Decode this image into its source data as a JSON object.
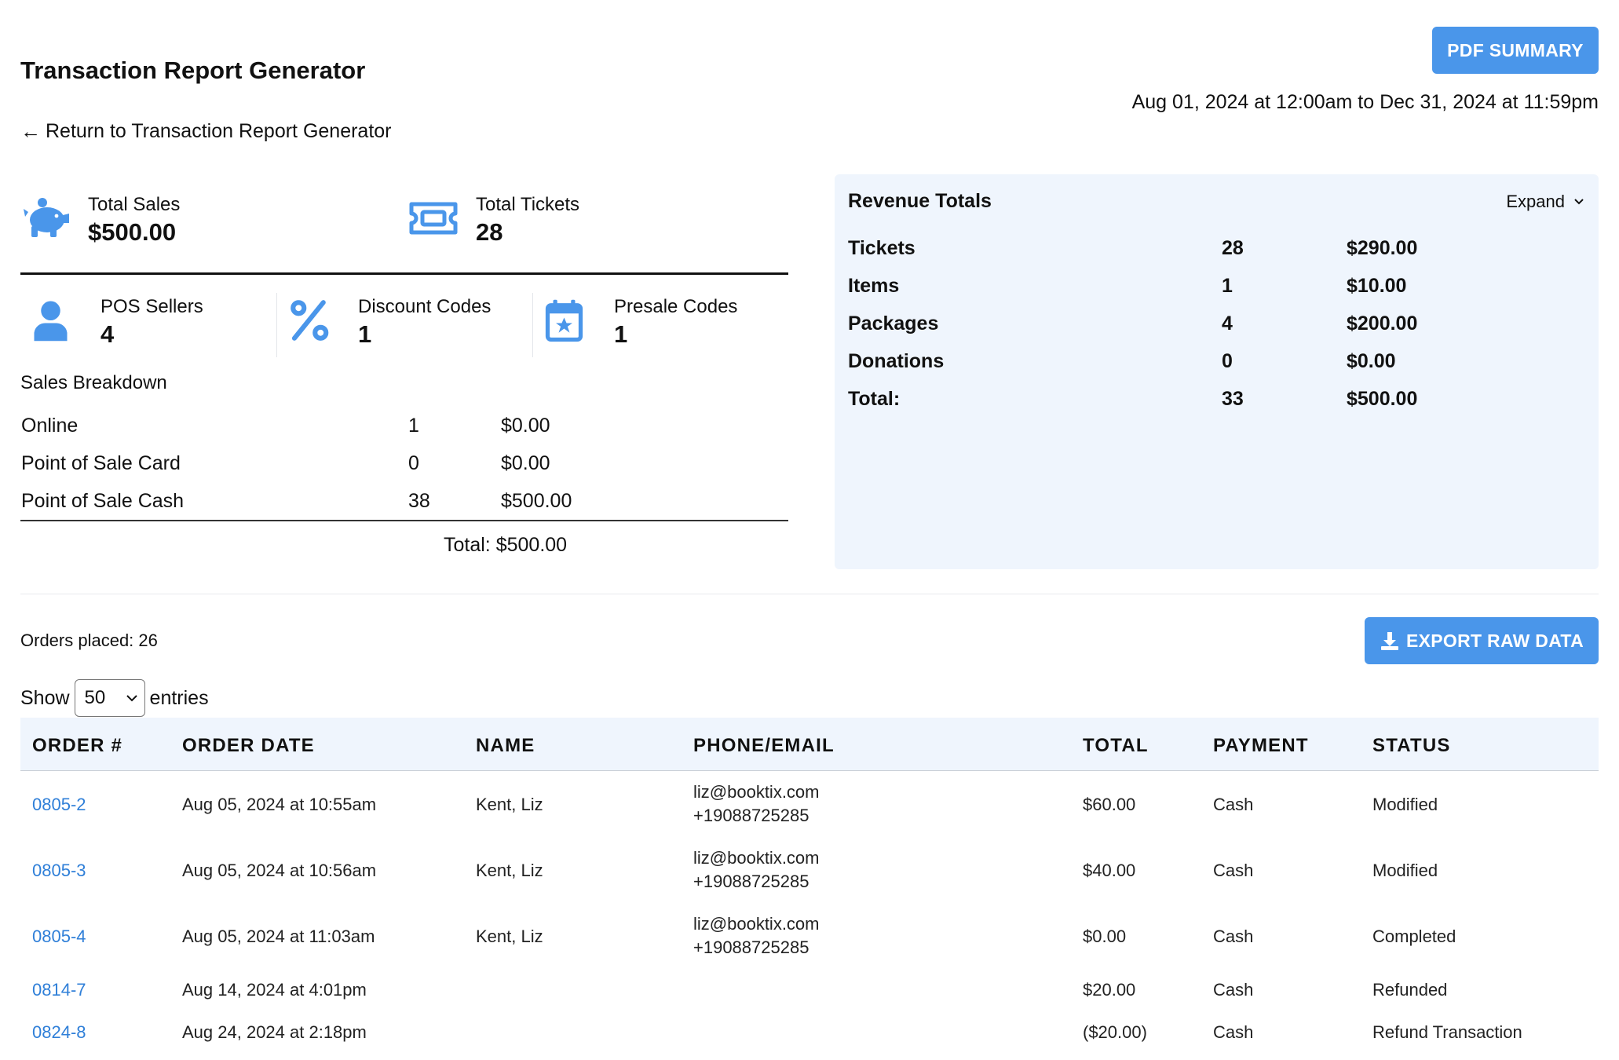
{
  "header": {
    "title": "Transaction Report Generator",
    "back_label": "Return to Transaction Report Generator",
    "pdf_label": "PDF SUMMARY",
    "date_range": "Aug 01, 2024 at 12:00am to Dec 31, 2024 at 11:59pm"
  },
  "stats": {
    "total_sales": {
      "label": "Total Sales",
      "value": "$500.00",
      "icon": "piggy-bank-icon"
    },
    "total_tickets": {
      "label": "Total Tickets",
      "value": "28",
      "icon": "ticket-icon"
    },
    "pos_sellers": {
      "label": "POS Sellers",
      "value": "4",
      "icon": "user-icon"
    },
    "discount_codes": {
      "label": "Discount Codes",
      "value": "1",
      "icon": "percent-icon"
    },
    "presale_codes": {
      "label": "Presale Codes",
      "value": "1",
      "icon": "calendar-star-icon"
    }
  },
  "sales_breakdown": {
    "title": "Sales Breakdown",
    "rows": [
      {
        "method": "Online",
        "count": "1",
        "amount": "$0.00"
      },
      {
        "method": "Point of Sale Card",
        "count": "0",
        "amount": "$0.00"
      },
      {
        "method": "Point of Sale Cash",
        "count": "38",
        "amount": "$500.00"
      }
    ],
    "total": "Total: $500.00"
  },
  "revenue": {
    "title": "Revenue Totals",
    "expand_label": "Expand",
    "rows": [
      {
        "label": "Tickets",
        "count": "28",
        "amount": "$290.00"
      },
      {
        "label": "Items",
        "count": "1",
        "amount": "$10.00"
      },
      {
        "label": "Packages",
        "count": "4",
        "amount": "$200.00"
      },
      {
        "label": "Donations",
        "count": "0",
        "amount": "$0.00"
      },
      {
        "label": "Total:",
        "count": "33",
        "amount": "$500.00"
      }
    ]
  },
  "orders": {
    "placed_label": "Orders placed: 26",
    "export_label": "EXPORT RAW DATA",
    "show_label": "Show",
    "entries_value": "50",
    "entries_label": "entries",
    "columns": [
      "ORDER #",
      "ORDER DATE",
      "NAME",
      "PHONE/EMAIL",
      "TOTAL",
      "PAYMENT",
      "STATUS"
    ],
    "rows": [
      {
        "order": "0805-2",
        "date": "Aug 05, 2024 at 10:55am",
        "name": "Kent, Liz",
        "email": "liz@booktix.com",
        "phone": "+19088725285",
        "total": "$60.00",
        "payment": "Cash",
        "status": "Modified"
      },
      {
        "order": "0805-3",
        "date": "Aug 05, 2024 at 10:56am",
        "name": "Kent, Liz",
        "email": "liz@booktix.com",
        "phone": "+19088725285",
        "total": "$40.00",
        "payment": "Cash",
        "status": "Modified"
      },
      {
        "order": "0805-4",
        "date": "Aug 05, 2024 at 11:03am",
        "name": "Kent, Liz",
        "email": "liz@booktix.com",
        "phone": "+19088725285",
        "total": "$0.00",
        "payment": "Cash",
        "status": "Completed"
      },
      {
        "order": "0814-7",
        "date": "Aug 14, 2024 at 4:01pm",
        "name": "",
        "email": "",
        "phone": "",
        "total": "$20.00",
        "payment": "Cash",
        "status": "Refunded"
      },
      {
        "order": "0824-8",
        "date": "Aug 24, 2024 at 2:18pm",
        "name": "",
        "email": "",
        "phone": "",
        "total": "($20.00)",
        "payment": "Cash",
        "status": "Refund Transaction"
      }
    ]
  },
  "colors": {
    "accent": "#4a96ea",
    "link": "#2f7fd8",
    "panel_bg": "#eff5fd"
  }
}
